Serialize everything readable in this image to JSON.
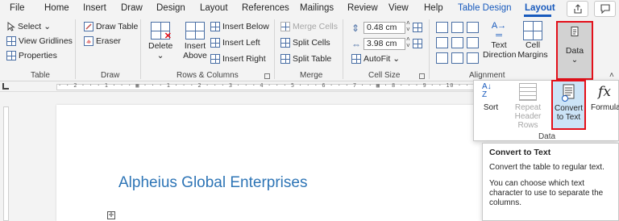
{
  "tabs": [
    "File",
    "Home",
    "Insert",
    "Draw",
    "Design",
    "Layout",
    "References",
    "Mailings",
    "Review",
    "View",
    "Help",
    "Table Design",
    "Layout"
  ],
  "ribbon": {
    "table": {
      "select": "Select",
      "view_gridlines": "View Gridlines",
      "properties": "Properties",
      "label": "Table"
    },
    "draw": {
      "draw_table": "Draw Table",
      "eraser": "Eraser",
      "label": "Draw"
    },
    "rows_columns": {
      "delete": "Delete",
      "insert_above_1": "Insert",
      "insert_above_2": "Above",
      "insert_below": "Insert Below",
      "insert_left": "Insert Left",
      "insert_right": "Insert Right",
      "label": "Rows & Columns"
    },
    "merge": {
      "merge_cells": "Merge Cells",
      "split_cells": "Split Cells",
      "split_table": "Split Table",
      "label": "Merge"
    },
    "cell_size": {
      "height": "0.48 cm",
      "width": "3.98 cm",
      "autofit": "AutoFit",
      "label": "Cell Size"
    },
    "alignment": {
      "text_direction_1": "Text",
      "text_direction_2": "Direction",
      "cell_margins_1": "Cell",
      "cell_margins_2": "Margins",
      "label": "Alignment"
    },
    "data": {
      "label": "Data"
    }
  },
  "ruler": {
    "ticks": "· · 2 · · · 1 · · · ▦ · · · 1 · · · 2 · · · 3 · · · 4 · · · 5 · · · 6 · · · 7 · · ▦ · 8 · · · 9 · · 10 · · 11 · · ▦ · 12 · · 13 · · 14"
  },
  "dropdown": {
    "sort": "Sort",
    "repeat_1": "Repeat",
    "repeat_2": "Header Rows",
    "convert_1": "Convert",
    "convert_2": "to Text",
    "formula": "Formula",
    "formula_glyph": "fx",
    "group_label": "Data"
  },
  "tooltip": {
    "title": "Convert to Text",
    "line1": "Convert the table to regular text.",
    "line2": "You can choose which text character to use to separate the columns."
  },
  "document": {
    "heading": "Alpheius Global Enterprises"
  },
  "colors": {
    "accent": "#185abd",
    "highlight": "#e3101a",
    "heading": "#2e75b6"
  }
}
